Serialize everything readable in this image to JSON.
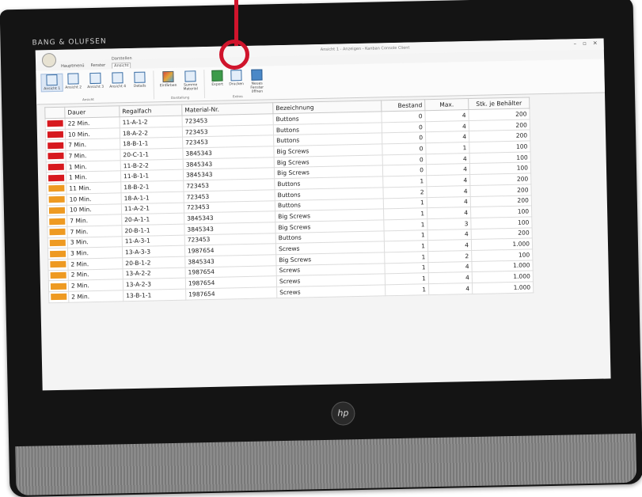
{
  "monitor": {
    "brand": "BANG & OLUFSEN",
    "logo": "hp"
  },
  "window": {
    "title": "Ansicht 1 - Anzeigen - Kanban Console Client",
    "controls": [
      "–",
      "▫",
      "✕"
    ]
  },
  "ribbon": {
    "context_label": "Darstellen",
    "tabs": [
      "Hauptmenü",
      "Fenster",
      "Ansicht"
    ],
    "active_tab": "Ansicht",
    "buttons": [
      {
        "label": "Ansicht 1",
        "icon": "view-1-icon"
      },
      {
        "label": "Ansicht 2",
        "icon": "view-2-icon"
      },
      {
        "label": "Ansicht 3",
        "icon": "view-3-icon"
      },
      {
        "label": "Ansicht 4",
        "icon": "view-4-icon"
      },
      {
        "label": "Details",
        "icon": "view-details-icon"
      },
      {
        "label": "Einfärben",
        "icon": "colorize-icon"
      },
      {
        "label": "Summe Material",
        "icon": "sum-icon"
      },
      {
        "label": "Export",
        "icon": "export-icon"
      },
      {
        "label": "Drucken",
        "icon": "print-icon"
      },
      {
        "label": "Neues Fenster öffnen",
        "icon": "new-window-icon"
      }
    ],
    "groups": [
      "Ansicht",
      "Darstellung",
      "Extras"
    ]
  },
  "table": {
    "headers": [
      "",
      "Dauer",
      "Regalfach",
      "Material-Nr.",
      "Bezeichnung",
      "Bestand",
      "Max.",
      "Stk. je Behälter"
    ],
    "status_colors": {
      "red": "#d7191f",
      "orange": "#ee9a22"
    },
    "rows": [
      {
        "status": "red",
        "dauer": "22 Min.",
        "regalfach": "11-A-1-2",
        "material": "723453",
        "bezeichnung": "Buttons",
        "bestand": "0",
        "max": "4",
        "stk": "200"
      },
      {
        "status": "red",
        "dauer": "10 Min.",
        "regalfach": "18-A-2-2",
        "material": "723453",
        "bezeichnung": "Buttons",
        "bestand": "0",
        "max": "4",
        "stk": "200"
      },
      {
        "status": "red",
        "dauer": "7 Min.",
        "regalfach": "18-B-1-1",
        "material": "723453",
        "bezeichnung": "Buttons",
        "bestand": "0",
        "max": "4",
        "stk": "200"
      },
      {
        "status": "red",
        "dauer": "7 Min.",
        "regalfach": "20-C-1-1",
        "material": "3845343",
        "bezeichnung": "Big Screws",
        "bestand": "0",
        "max": "1",
        "stk": "100"
      },
      {
        "status": "red",
        "dauer": "1 Min.",
        "regalfach": "11-B-2-2",
        "material": "3845343",
        "bezeichnung": "Big Screws",
        "bestand": "0",
        "max": "4",
        "stk": "100"
      },
      {
        "status": "red",
        "dauer": "1 Min.",
        "regalfach": "11-B-1-1",
        "material": "3845343",
        "bezeichnung": "Big Screws",
        "bestand": "0",
        "max": "4",
        "stk": "100"
      },
      {
        "status": "orange",
        "dauer": "11 Min.",
        "regalfach": "18-B-2-1",
        "material": "723453",
        "bezeichnung": "Buttons",
        "bestand": "1",
        "max": "4",
        "stk": "200"
      },
      {
        "status": "orange",
        "dauer": "10 Min.",
        "regalfach": "18-A-1-1",
        "material": "723453",
        "bezeichnung": "Buttons",
        "bestand": "2",
        "max": "4",
        "stk": "200"
      },
      {
        "status": "orange",
        "dauer": "10 Min.",
        "regalfach": "11-A-2-1",
        "material": "723453",
        "bezeichnung": "Buttons",
        "bestand": "1",
        "max": "4",
        "stk": "200"
      },
      {
        "status": "orange",
        "dauer": "7 Min.",
        "regalfach": "20-A-1-1",
        "material": "3845343",
        "bezeichnung": "Big Screws",
        "bestand": "1",
        "max": "4",
        "stk": "100"
      },
      {
        "status": "orange",
        "dauer": "7 Min.",
        "regalfach": "20-B-1-1",
        "material": "3845343",
        "bezeichnung": "Big Screws",
        "bestand": "1",
        "max": "3",
        "stk": "100"
      },
      {
        "status": "orange",
        "dauer": "3 Min.",
        "regalfach": "11-A-3-1",
        "material": "723453",
        "bezeichnung": "Buttons",
        "bestand": "1",
        "max": "4",
        "stk": "200"
      },
      {
        "status": "orange",
        "dauer": "3 Min.",
        "regalfach": "13-A-3-3",
        "material": "1987654",
        "bezeichnung": "Screws",
        "bestand": "1",
        "max": "4",
        "stk": "1.000"
      },
      {
        "status": "orange",
        "dauer": "2 Min.",
        "regalfach": "20-B-1-2",
        "material": "3845343",
        "bezeichnung": "Big Screws",
        "bestand": "1",
        "max": "2",
        "stk": "100"
      },
      {
        "status": "orange",
        "dauer": "2 Min.",
        "regalfach": "13-A-2-2",
        "material": "1987654",
        "bezeichnung": "Screws",
        "bestand": "1",
        "max": "4",
        "stk": "1.000"
      },
      {
        "status": "orange",
        "dauer": "2 Min.",
        "regalfach": "13-A-2-3",
        "material": "1987654",
        "bezeichnung": "Screws",
        "bestand": "1",
        "max": "4",
        "stk": "1.000"
      },
      {
        "status": "orange",
        "dauer": "2 Min.",
        "regalfach": "13-B-1-1",
        "material": "1987654",
        "bezeichnung": "Screws",
        "bestand": "1",
        "max": "4",
        "stk": "1.000"
      }
    ]
  },
  "annotation": {
    "color": "#d0142c"
  }
}
